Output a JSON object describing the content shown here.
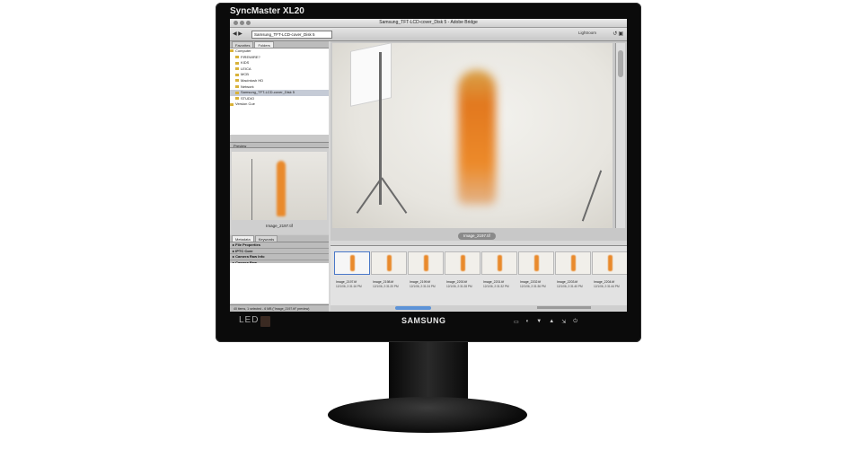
{
  "monitor": {
    "model": "SyncMaster XL20",
    "brand": "SAMSUNG",
    "led_badge": "LED",
    "controls": [
      "menu-icon",
      "magic-icon",
      "down-icon",
      "up-icon",
      "source-icon",
      "power-icon"
    ]
  },
  "app": {
    "window_title": "Samsung_TFT-LCD-cover_Disk 5 - Adobe Bridge",
    "path": "Samsung_TFT-LCD-cover_Disk 5",
    "workspace": "Lightroom",
    "left_tabs": [
      "Favorites",
      "Folders"
    ],
    "folders": [
      {
        "label": "Computer",
        "selected": false
      },
      {
        "label": "FIREWIRE?",
        "selected": false
      },
      {
        "label": "KIDS",
        "selected": false
      },
      {
        "label": "LEICA",
        "selected": false
      },
      {
        "label": "MCB",
        "selected": false
      },
      {
        "label": "Macintosh HD",
        "selected": false
      },
      {
        "label": "Network",
        "selected": false
      },
      {
        "label": "Samsung_TFT-LCD-cover_Disk 5",
        "selected": true
      },
      {
        "label": "STUDIO",
        "selected": false
      },
      {
        "label": "Version Cue",
        "selected": false
      }
    ],
    "preview_panel_title": "Preview",
    "preview_caption": "Image_2197.tif",
    "meta_tabs": [
      "Metadata",
      "Keywords"
    ],
    "meta_sections": [
      "File Properties",
      "IPTC Core",
      "Camera Raw Info",
      "Camera Raw"
    ],
    "status_text": "40 items, 1 selected - 6 MB (\"Image_2197.tif\" preview)",
    "main_caption": "Image_2197.tif",
    "thumbnails": [
      {
        "name": "Image_2197.tif",
        "date": "12/1/06, 2:31:16 PM",
        "selected": true
      },
      {
        "name": "Image_2198.tif",
        "date": "12/1/06, 2:31:20 PM",
        "selected": false
      },
      {
        "name": "Image_2199.tif",
        "date": "12/1/06, 2:31:24 PM",
        "selected": false
      },
      {
        "name": "Image_2200.tif",
        "date": "12/1/06, 2:31:28 PM",
        "selected": false
      },
      {
        "name": "Image_2201.tif",
        "date": "12/1/06, 2:31:32 PM",
        "selected": false
      },
      {
        "name": "Image_2202.tif",
        "date": "12/1/06, 2:31:36 PM",
        "selected": false
      },
      {
        "name": "Image_2203.tif",
        "date": "12/1/06, 2:31:40 PM",
        "selected": false
      },
      {
        "name": "Image_2204.tif",
        "date": "12/1/06, 2:31:44 PM",
        "selected": false
      }
    ]
  },
  "colors": {
    "bezel": "#0b0b0b",
    "dress": "#e98a2c",
    "selection": "#4a78c8"
  }
}
